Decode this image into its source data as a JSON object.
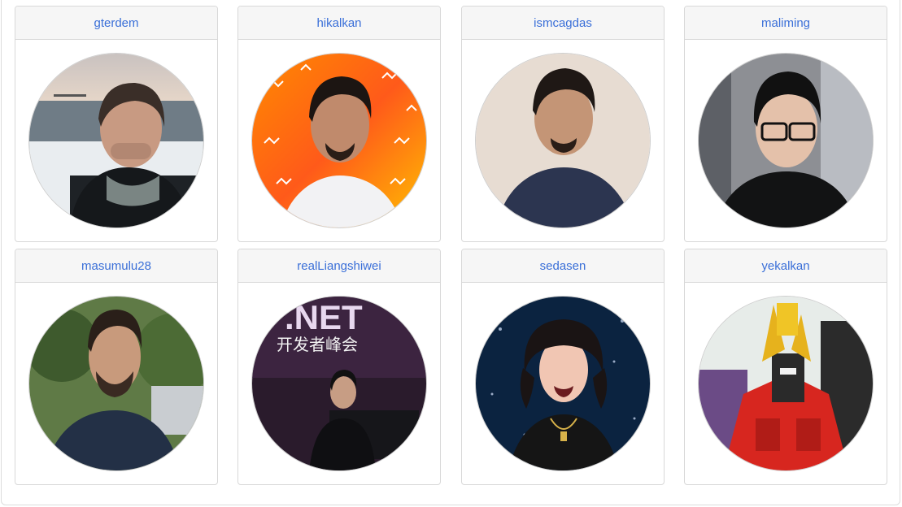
{
  "contributors": [
    {
      "username": "gterdem"
    },
    {
      "username": "hikalkan"
    },
    {
      "username": "ismcagdas"
    },
    {
      "username": "maliming"
    },
    {
      "username": "masumulu28"
    },
    {
      "username": "realLiangshiwei",
      "photo_text": {
        "line1": ".NET",
        "line2": "开发者峰会"
      }
    },
    {
      "username": "sedasen"
    },
    {
      "username": "yekalkan"
    }
  ]
}
